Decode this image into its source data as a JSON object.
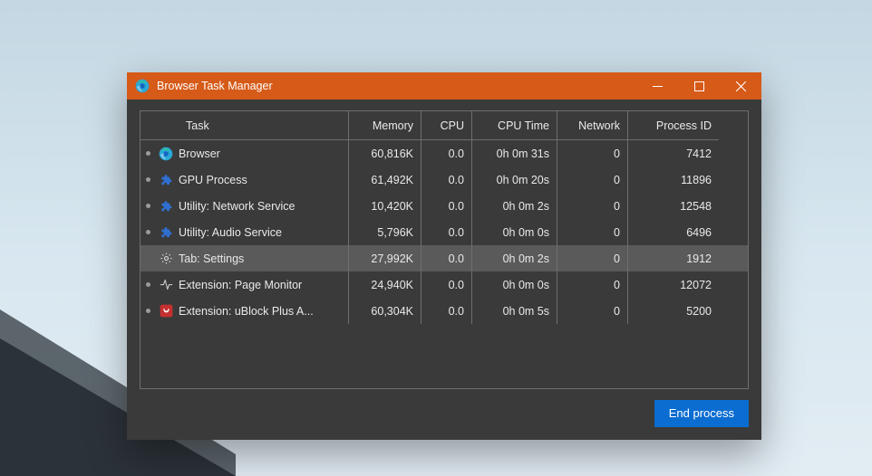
{
  "window": {
    "title": "Browser Task Manager"
  },
  "columns": {
    "task": "Task",
    "memory": "Memory",
    "cpu": "CPU",
    "cpu_time": "CPU Time",
    "network": "Network",
    "process_id": "Process ID"
  },
  "rows": [
    {
      "icon": "edge",
      "bullet": true,
      "task": "Browser",
      "memory": "60,816K",
      "cpu": "0.0",
      "cpu_time": "0h 0m 31s",
      "network": "0",
      "pid": "7412",
      "selected": false
    },
    {
      "icon": "puzzle",
      "bullet": true,
      "task": "GPU Process",
      "memory": "61,492K",
      "cpu": "0.0",
      "cpu_time": "0h 0m 20s",
      "network": "0",
      "pid": "11896",
      "selected": false
    },
    {
      "icon": "puzzle",
      "bullet": true,
      "task": "Utility: Network Service",
      "memory": "10,420K",
      "cpu": "0.0",
      "cpu_time": "0h 0m 2s",
      "network": "0",
      "pid": "12548",
      "selected": false
    },
    {
      "icon": "puzzle",
      "bullet": true,
      "task": "Utility: Audio Service",
      "memory": "5,796K",
      "cpu": "0.0",
      "cpu_time": "0h 0m 0s",
      "network": "0",
      "pid": "6496",
      "selected": false
    },
    {
      "icon": "gear",
      "bullet": false,
      "task": "Tab: Settings",
      "memory": "27,992K",
      "cpu": "0.0",
      "cpu_time": "0h 0m 2s",
      "network": "0",
      "pid": "1912",
      "selected": true
    },
    {
      "icon": "activity",
      "bullet": true,
      "task": "Extension: Page Monitor",
      "memory": "24,940K",
      "cpu": "0.0",
      "cpu_time": "0h 0m 0s",
      "network": "0",
      "pid": "12072",
      "selected": false
    },
    {
      "icon": "ublock",
      "bullet": true,
      "task": "Extension: uBlock Plus A...",
      "memory": "60,304K",
      "cpu": "0.0",
      "cpu_time": "0h 0m 5s",
      "network": "0",
      "pid": "5200",
      "selected": false
    }
  ],
  "buttons": {
    "end_process": "End process"
  }
}
